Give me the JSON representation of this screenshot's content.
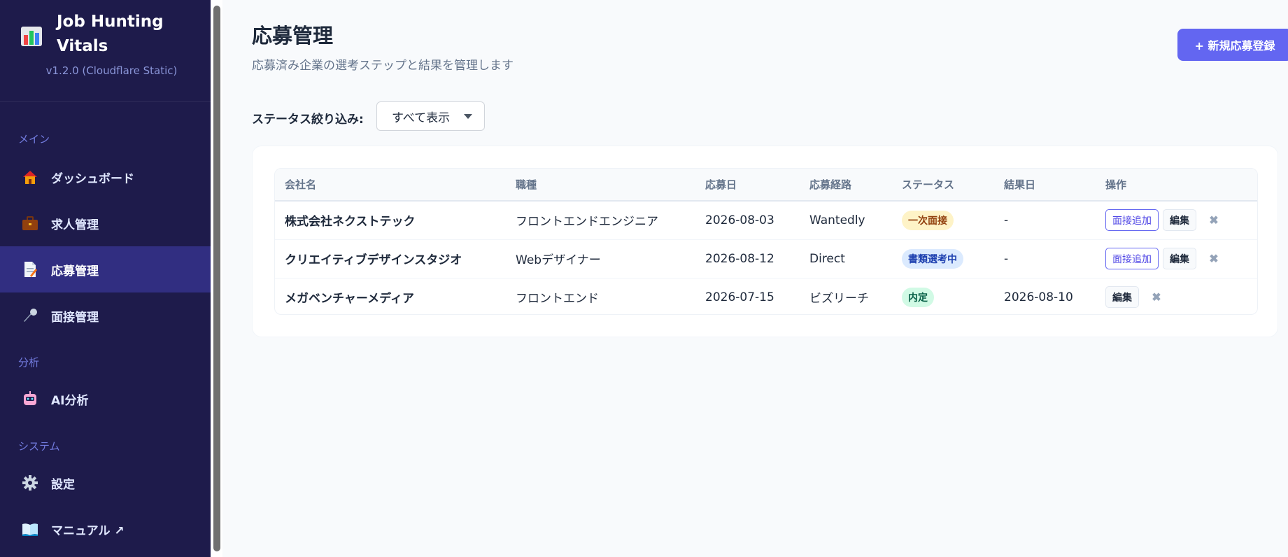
{
  "brand": {
    "title": "Job Hunting Vitals",
    "version": "v1.2.0 (Cloudflare Static)"
  },
  "sidebar": {
    "sections": [
      {
        "label": "メイン"
      },
      {
        "label": "分析"
      },
      {
        "label": "システム"
      }
    ],
    "items": [
      {
        "label": "ダッシュボード",
        "icon": "house-icon",
        "active": false
      },
      {
        "label": "求人管理",
        "icon": "briefcase-icon",
        "active": false
      },
      {
        "label": "応募管理",
        "icon": "document-icon",
        "active": true
      },
      {
        "label": "面接管理",
        "icon": "microphone-icon",
        "active": false
      },
      {
        "label": "AI分析",
        "icon": "robot-icon",
        "active": false
      },
      {
        "label": "設定",
        "icon": "gear-icon",
        "active": false
      },
      {
        "label": "マニュアル ↗",
        "icon": "book-icon",
        "active": false
      }
    ]
  },
  "header": {
    "title": "応募管理",
    "subtitle": "応募済み企業の選考ステップと結果を管理します",
    "new_button": "+ 新規応募登録"
  },
  "filter": {
    "label": "ステータス絞り込み:",
    "selected": "すべて表示"
  },
  "table": {
    "columns": [
      "会社名",
      "職種",
      "応募日",
      "応募経路",
      "ステータス",
      "結果日",
      "操作"
    ],
    "rows": [
      {
        "company": "株式会社ネクストテック",
        "role": "フロントエンドエンジニア",
        "applied": "2026-08-03",
        "route": "Wantedly",
        "status": "一次面接",
        "status_color": "#fef3c7",
        "result": "-",
        "add_interview": "面接追加",
        "edit": "編集",
        "delete": "✖"
      },
      {
        "company": "クリエイティブデザインスタジオ",
        "role": "Webデザイナー",
        "applied": "2026-08-12",
        "route": "Direct",
        "status": "書類選考中",
        "status_color": "#dbeafe",
        "result": "-",
        "add_interview": "面接追加",
        "edit": "編集",
        "delete": "✖"
      },
      {
        "company": "メガベンチャーメディア",
        "role": "フロントエンド",
        "applied": "2026-07-15",
        "route": "ビズリーチ",
        "status": "内定",
        "status_color": "#d1fae5",
        "result": "2026-08-10",
        "edit": "編集",
        "delete": "✖"
      }
    ]
  },
  "colors": {
    "sidebar_bg": "#1e1b4b",
    "sidebar_active": "#312e81",
    "accent": "#6366f1"
  }
}
